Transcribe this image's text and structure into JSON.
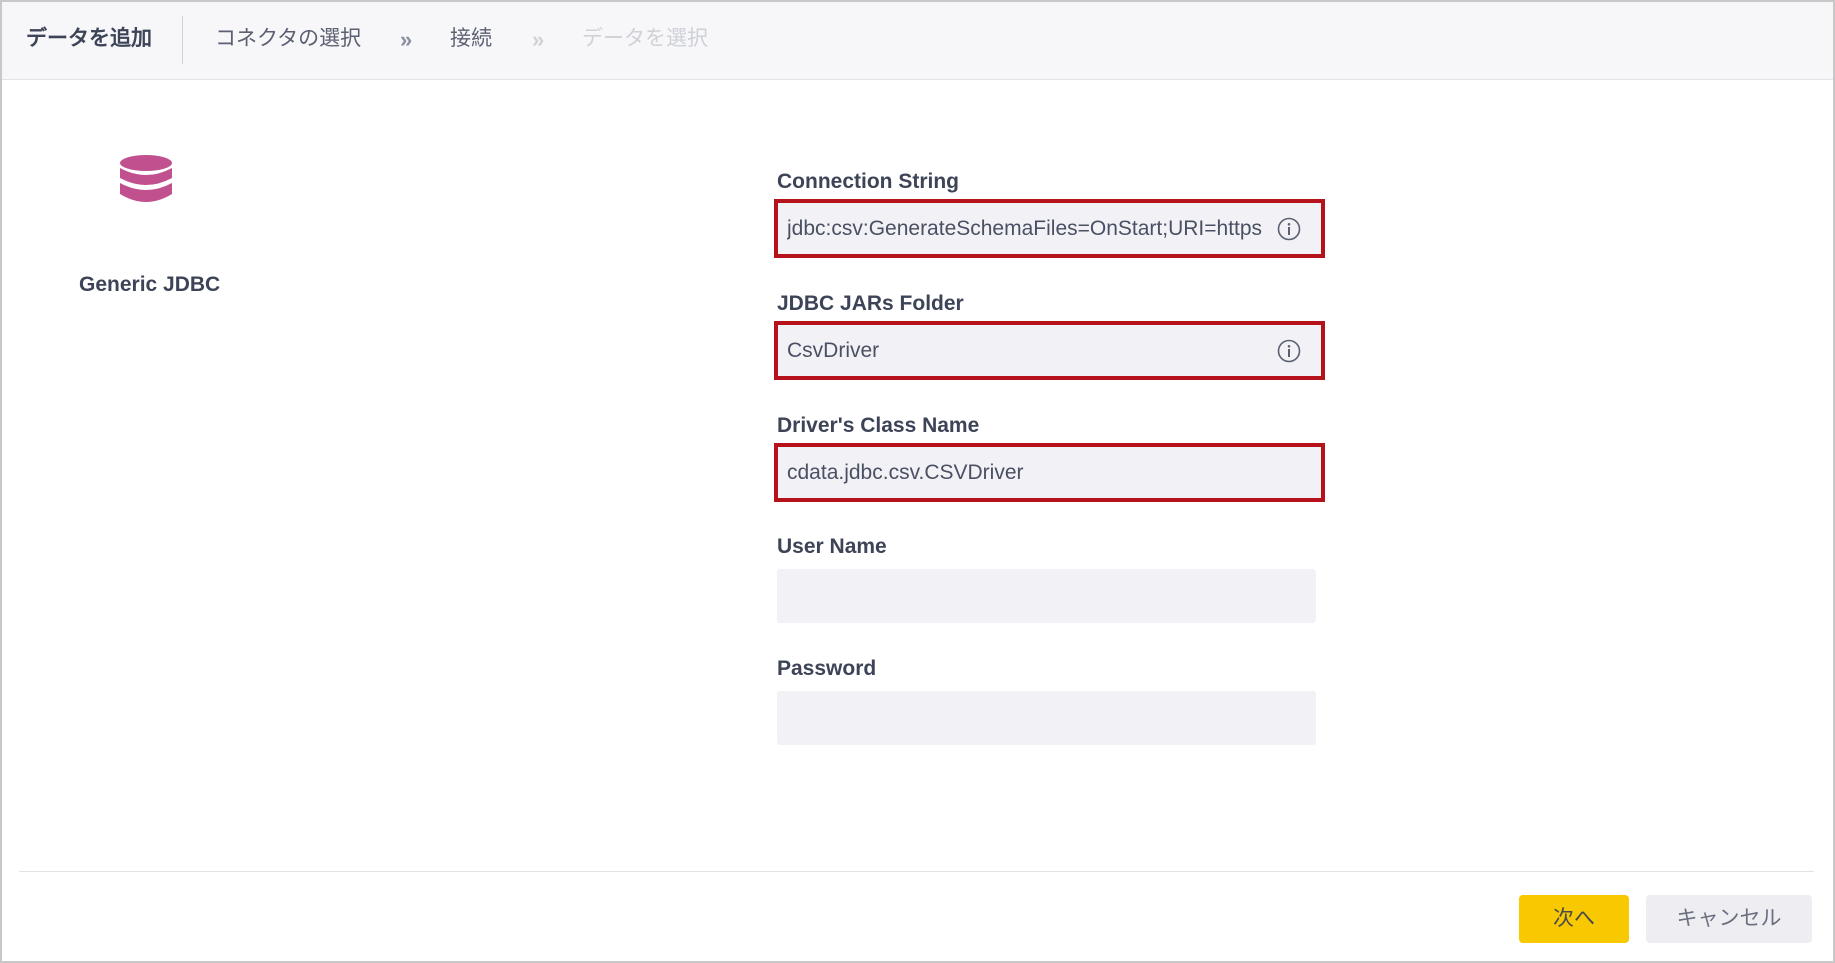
{
  "header": {
    "title": "データを追加",
    "steps": [
      {
        "label": "コネクタの選択"
      },
      {
        "label": "接続"
      },
      {
        "label": "データを選択"
      }
    ],
    "separator": "»"
  },
  "connector": {
    "icon": "database-icon",
    "name": "Generic JDBC",
    "icon_color": "#c1508f"
  },
  "form": {
    "connection_string": {
      "label": "Connection String",
      "value": "jdbc:csv:GenerateSchemaFiles=OnStart;URI=https",
      "icon": "info-icon",
      "highlighted": true
    },
    "jars_folder": {
      "label": "JDBC JARs Folder",
      "value": "CsvDriver",
      "icon": "info-icon",
      "highlighted": true
    },
    "class_name": {
      "label": "Driver's Class Name",
      "value": "cdata.jdbc.csv.CSVDriver",
      "highlighted": true
    },
    "user_name": {
      "label": "User Name",
      "value": ""
    },
    "password": {
      "label": "Password",
      "value": ""
    }
  },
  "footer": {
    "next_label": "次へ",
    "cancel_label": "キャンセル"
  },
  "colors": {
    "highlight_border": "#b5121b",
    "primary_button": "#f8c800",
    "input_background": "#f2f2f6"
  }
}
